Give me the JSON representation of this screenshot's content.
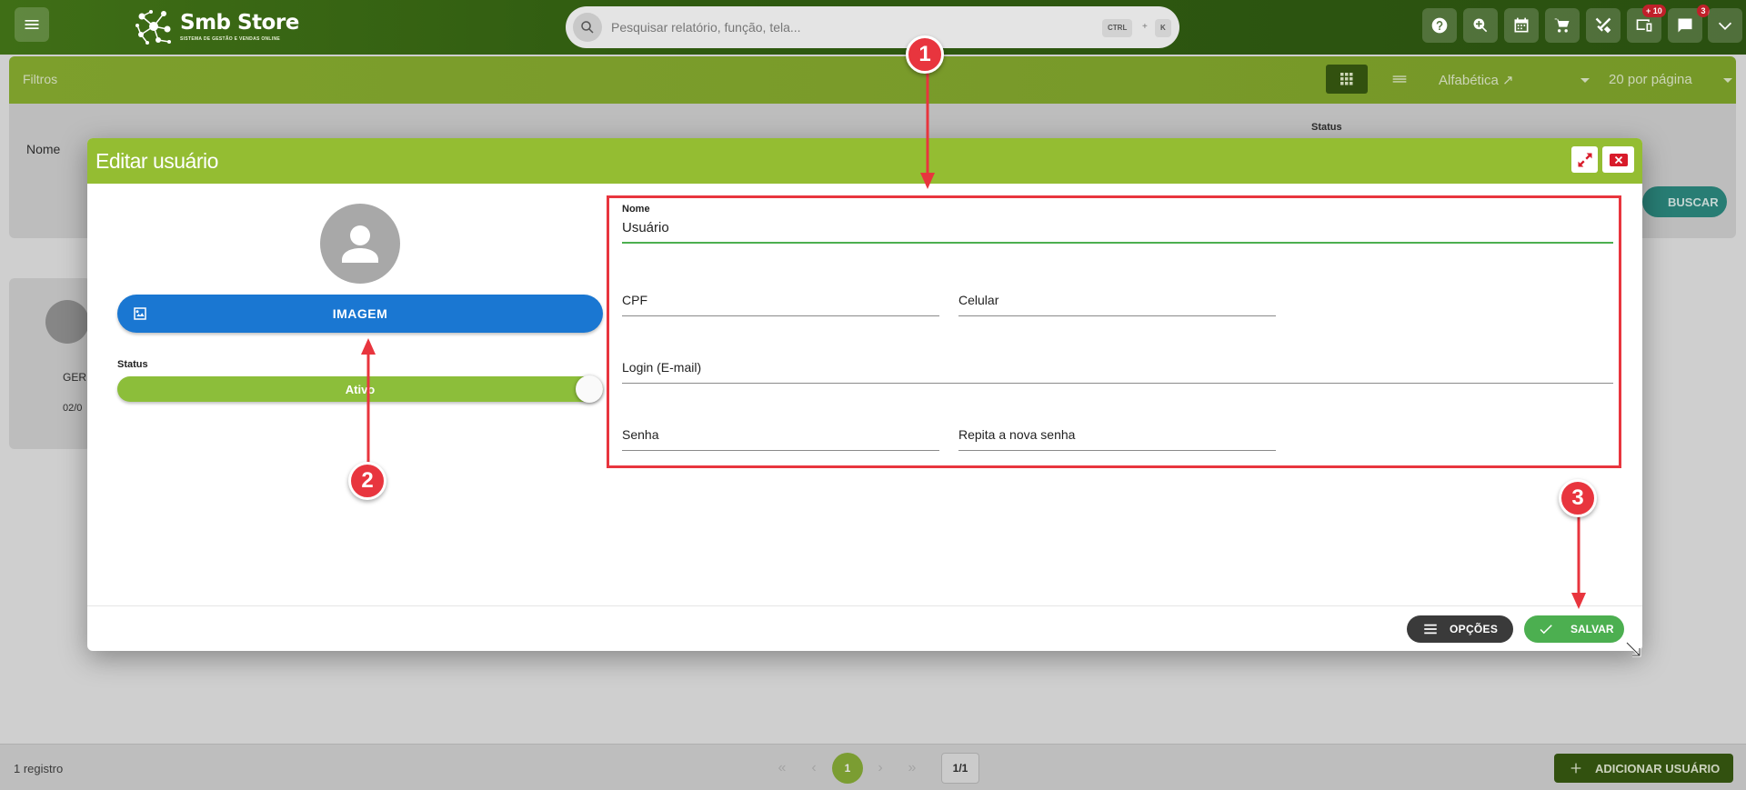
{
  "topbar": {
    "brand": "Smb Store",
    "brand_sub": "SISTEMA DE GESTÃO E VENDAS ONLINE",
    "search_placeholder": "Pesquisar relatório, função, tela...",
    "shortcut_key1": "CTRL",
    "shortcut_plus": "+",
    "shortcut_key2": "K",
    "badge_devices": "+ 10",
    "badge_messages": "3"
  },
  "filters": {
    "title": "Filtros",
    "sort_label": "Alfabética ↗",
    "per_page_label": "20 por página",
    "name_label": "Nome",
    "status_label": "Status",
    "search_button": "BUSCAR"
  },
  "background_card": {
    "role": "GER",
    "date": "02/0"
  },
  "modal": {
    "title": "Editar usuário",
    "image_button": "IMAGEM",
    "status_label": "Status",
    "status_value": "Ativo",
    "fields": {
      "nome_label": "Nome",
      "nome_value": "Usuário",
      "cpf_label": "CPF",
      "celular_label": "Celular",
      "login_label": "Login (E-mail)",
      "senha_label": "Senha",
      "repita_label": "Repita a nova senha"
    },
    "options_button": "OPÇÕES",
    "save_button": "SALVAR"
  },
  "annotations": {
    "m1": "1",
    "m2": "2",
    "m3": "3"
  },
  "footer": {
    "records": "1 registro",
    "current_page": "1",
    "page_total": "1/1",
    "add_button": "ADICIONAR USUÁRIO"
  },
  "colors": {
    "topbar": "#2f5a10",
    "accent_green": "#94bd32",
    "primary_blue": "#1a77d2",
    "save_green": "#4caf50",
    "annotation_red": "#e8353e"
  }
}
